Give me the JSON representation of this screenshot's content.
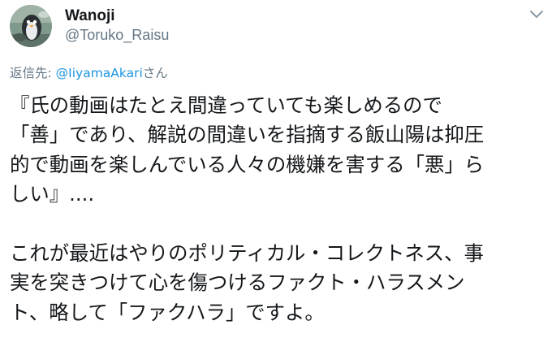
{
  "author": {
    "display_name": "Wanoji",
    "handle": "@Toruko_Raisu"
  },
  "reply": {
    "prefix": "返信先: ",
    "mention": "@IiyamaAkari",
    "suffix": "さん"
  },
  "tweet": {
    "lines": [
      "『氏の動画はたとえ間違っていても楽しめるので",
      "「善」であり、解説の間違いを指摘する飯山陽は抑圧",
      "的で動画を楽しんでいる人々の機嫌を害する「悪」ら",
      "しい』....",
      "これが最近はやりのポリティカル・コレクトネス、事",
      "実を突きつけて心を傷つけるファクト・ハラスメン",
      "ト、略して「ファクハラ」ですよ。"
    ]
  },
  "colors": {
    "text": "#14171a",
    "secondary": "#657786",
    "link": "#1b95e0"
  },
  "icons": {
    "menu": "chevron-down-icon",
    "avatar": "avatar-image"
  }
}
